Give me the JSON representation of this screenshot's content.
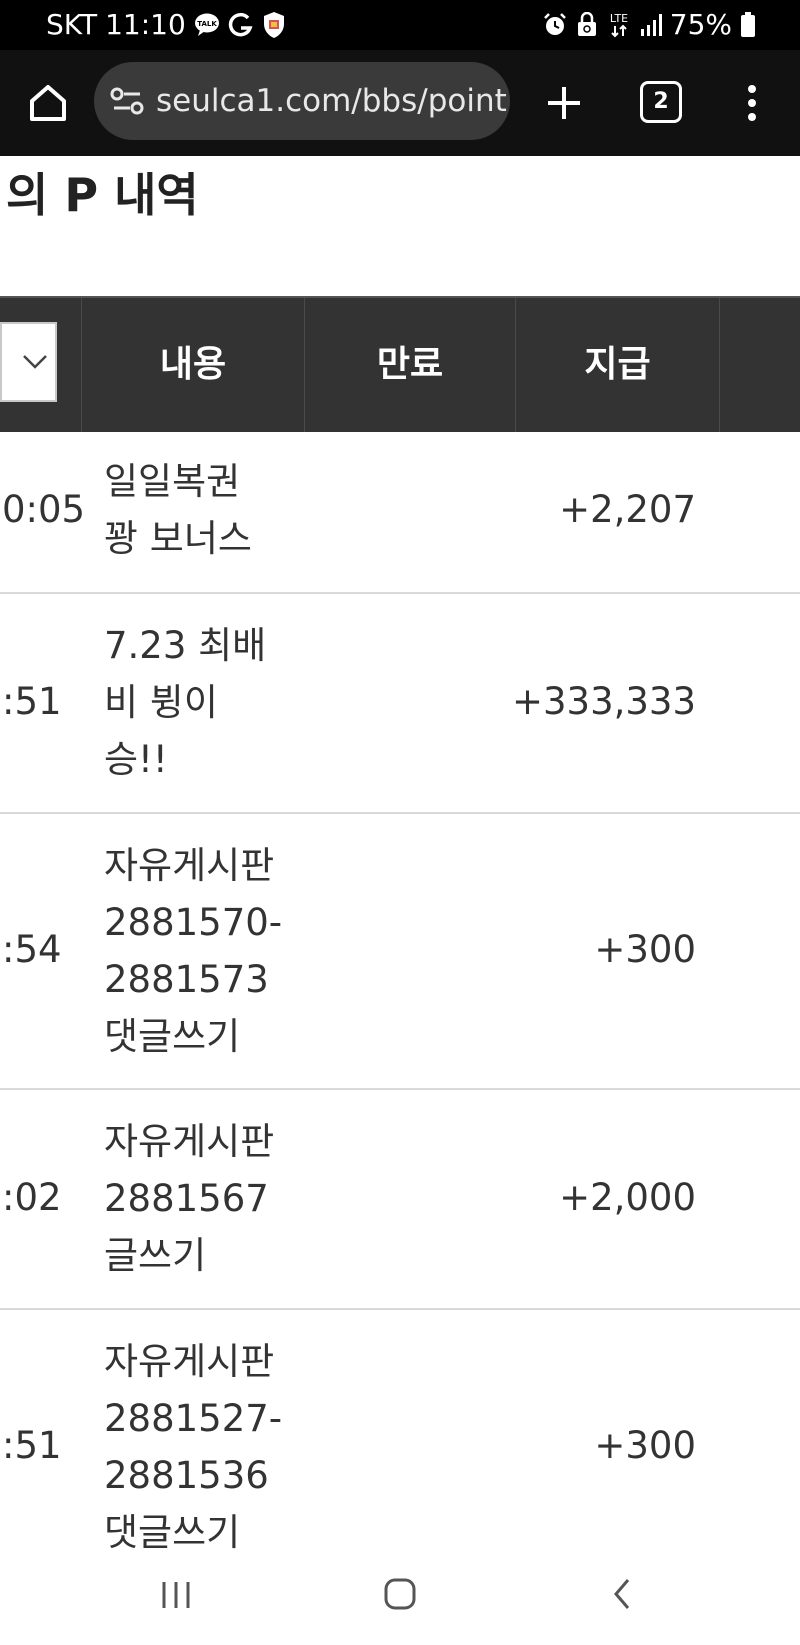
{
  "status_bar": {
    "carrier": "SKT",
    "time": "11:10",
    "battery_percent": "75%",
    "network": "LTE",
    "icons_left": [
      "talk-icon",
      "g-icon",
      "shield-app-icon"
    ],
    "icons_right": [
      "alarm-icon",
      "recycle-lock-icon",
      "lte-icon",
      "signal-icon",
      "battery-icon"
    ]
  },
  "browser": {
    "url": "seulca1.com/bbs/point",
    "tab_count": "2",
    "colors": {
      "toolbar": "#111111",
      "urlbar": "#3a3a3a"
    }
  },
  "page": {
    "title": "의 P 내역"
  },
  "table": {
    "headers": {
      "content": "내용",
      "expire": "만료",
      "grant": "지급"
    },
    "rows": [
      {
        "time": "0:05",
        "content_lines": [
          "일일복권",
          "꽝 보너스"
        ],
        "amount": "+2,207"
      },
      {
        "time": ":51",
        "content_lines": [
          "7.23 최배",
          "비 뷩이",
          "승!!"
        ],
        "amount": "+333,333"
      },
      {
        "time": ":54",
        "content_lines": [
          "자유게시판",
          "2881570-",
          "2881573",
          "댓글쓰기"
        ],
        "amount": "+300"
      },
      {
        "time": ":02",
        "content_lines": [
          "자유게시판",
          "2881567",
          "글쓰기"
        ],
        "amount": "+2,000"
      },
      {
        "time": ":51",
        "content_lines": [
          "자유게시판",
          "2881527-",
          "2881536",
          "댓글쓰기"
        ],
        "amount": "+300"
      }
    ]
  },
  "nav": {
    "icons": [
      "recent-apps-icon",
      "home-nav-icon",
      "back-nav-icon"
    ]
  }
}
